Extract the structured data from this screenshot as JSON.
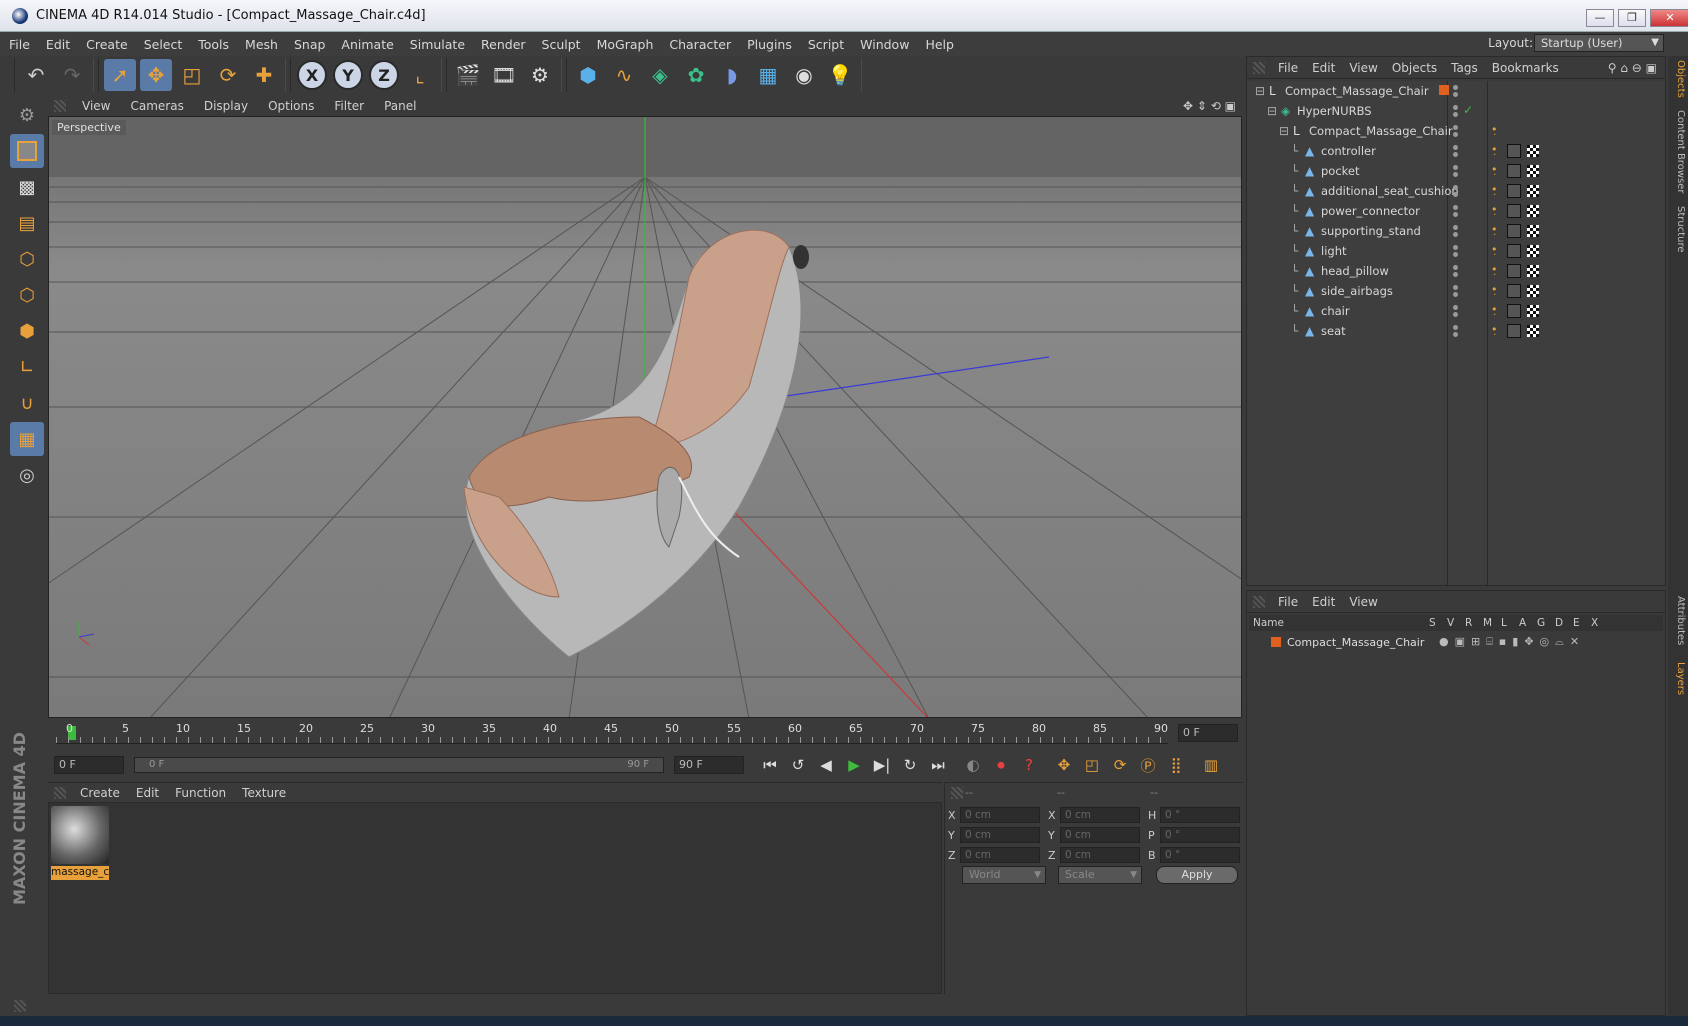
{
  "window": {
    "title": "CINEMA 4D R14.014 Studio - [Compact_Massage_Chair.c4d]",
    "minimize": "—",
    "restore": "❐",
    "close": "✕"
  },
  "menu": [
    "File",
    "Edit",
    "Create",
    "Select",
    "Tools",
    "Mesh",
    "Snap",
    "Animate",
    "Simulate",
    "Render",
    "Sculpt",
    "MoGraph",
    "Character",
    "Plugins",
    "Script",
    "Window",
    "Help"
  ],
  "layout": {
    "label": "Layout:",
    "value": "Startup (User)"
  },
  "viewport": {
    "menu": [
      "View",
      "Cameras",
      "Display",
      "Options",
      "Filter",
      "Panel"
    ],
    "label": "Perspective"
  },
  "timeline": {
    "ticks": [
      "0",
      "5",
      "10",
      "15",
      "20",
      "25",
      "30",
      "35",
      "40",
      "45",
      "50",
      "55",
      "60",
      "65",
      "70",
      "75",
      "80",
      "85",
      "90"
    ],
    "current_frame": "0 F",
    "start_field": "0 F",
    "range_start": "0 F",
    "range_end": "90 F",
    "end_field": "90 F"
  },
  "material_manager": {
    "menu": [
      "Create",
      "Edit",
      "Function",
      "Texture"
    ],
    "materials": [
      {
        "name": "massage_ch"
      }
    ]
  },
  "coordinates": {
    "headers": [
      "--",
      "--",
      "--"
    ],
    "rows": [
      {
        "a": "X",
        "av": "0 cm",
        "b": "X",
        "bv": "0 cm",
        "c": "H",
        "cv": "0 °"
      },
      {
        "a": "Y",
        "av": "0 cm",
        "b": "Y",
        "bv": "0 cm",
        "c": "P",
        "cv": "0 °"
      },
      {
        "a": "Z",
        "av": "0 cm",
        "b": "Z",
        "bv": "0 cm",
        "c": "B",
        "cv": "0 °"
      }
    ],
    "mode": "World",
    "scale": "Scale",
    "apply": "Apply"
  },
  "object_manager": {
    "menu": [
      "File",
      "Edit",
      "View",
      "Objects",
      "Tags",
      "Bookmarks"
    ],
    "objects": [
      {
        "name": "Compact_Massage_Chair",
        "level": 0
      },
      {
        "name": "HyperNURBS",
        "level": 1
      },
      {
        "name": "Compact_Massage_Chair",
        "level": 2
      },
      {
        "name": "controller",
        "level": 3
      },
      {
        "name": "pocket",
        "level": 3
      },
      {
        "name": "additional_seat_cushion",
        "level": 3
      },
      {
        "name": "power_connector",
        "level": 3
      },
      {
        "name": "supporting_stand",
        "level": 3
      },
      {
        "name": "light",
        "level": 3
      },
      {
        "name": "head_pillow",
        "level": 3
      },
      {
        "name": "side_airbags",
        "level": 3
      },
      {
        "name": "chair",
        "level": 3
      },
      {
        "name": "seat",
        "level": 3
      }
    ]
  },
  "attribute_manager": {
    "menu": [
      "File",
      "Edit",
      "View"
    ],
    "columns": [
      "Name",
      "S",
      "V",
      "R",
      "M",
      "L",
      "A",
      "G",
      "D",
      "E",
      "X"
    ],
    "layers": [
      {
        "name": "Compact_Massage_Chair"
      }
    ]
  },
  "side_tabs": [
    "Objects",
    "Content Browser",
    "Structure",
    "Attributes",
    "Layers"
  ],
  "branding": "MAXON CINEMA 4D",
  "colors": {
    "accent": "#e8a13a",
    "selected": "#5a7aa8",
    "layer": "#e06020"
  }
}
